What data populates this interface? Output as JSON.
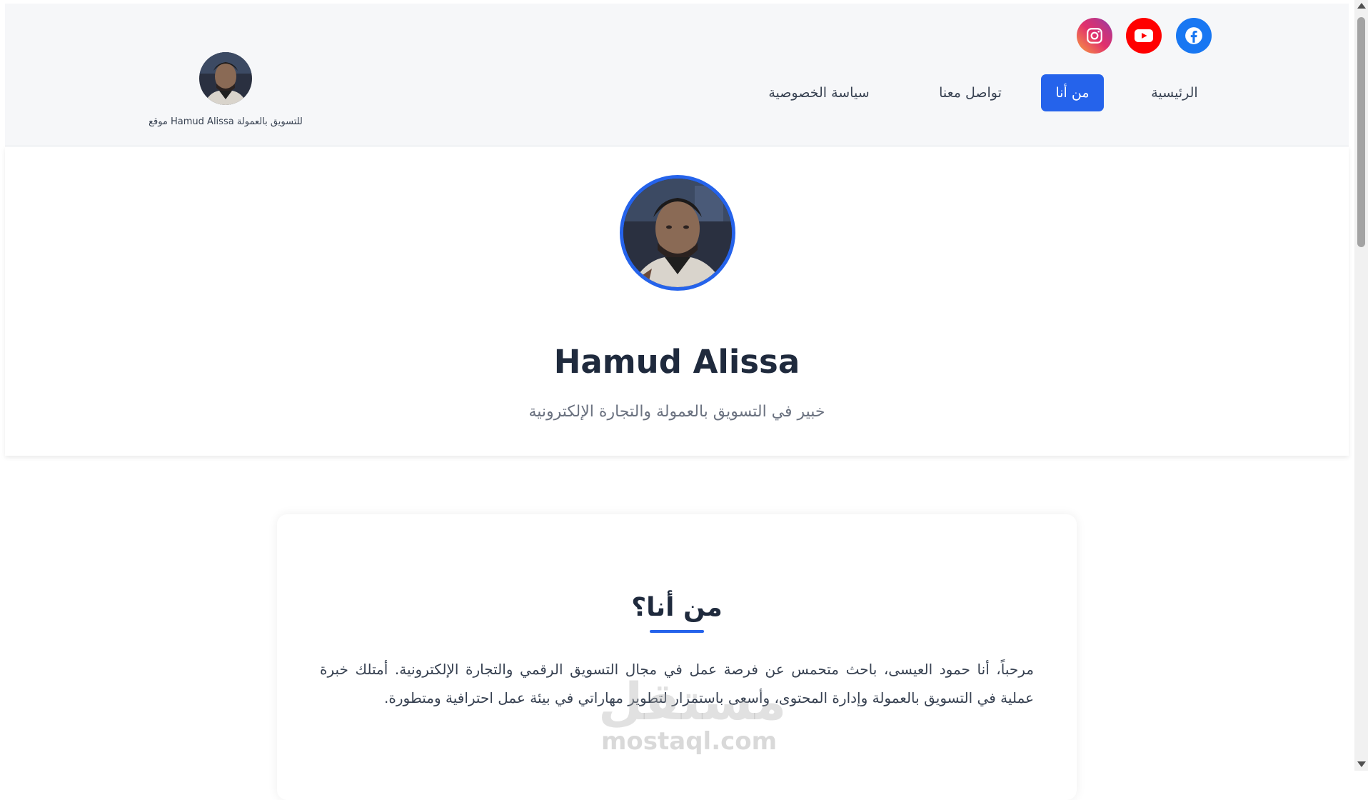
{
  "header": {
    "logo_caption": "موقع Hamud Alissa للتسويق بالعمولة",
    "nav": {
      "home": "الرئيسية",
      "about": "من أنا",
      "contact": "تواصل معنا",
      "privacy": "سياسة الخصوصية"
    },
    "social": [
      "facebook-icon",
      "youtube-icon",
      "instagram-icon"
    ]
  },
  "hero": {
    "name": "Hamud Alissa",
    "subtitle": "خبير في التسويق بالعمولة والتجارة الإلكترونية"
  },
  "about": {
    "title": "من أنا؟",
    "paragraph": "مرحباً، أنا حمود العيسى، باحث متحمس عن فرصة عمل في مجال التسويق الرقمي والتجارة الإلكترونية. أمتلك خبرة عملية في التسويق بالعمولة وإدارة المحتوى، وأسعى باستمرار لتطوير مهاراتي في بيئة عمل احترافية ومتطورة."
  },
  "watermark": {
    "arabic": "مستقل",
    "latin": "mostaql.com"
  },
  "colors": {
    "accent": "#2563eb",
    "facebook": "#1877f2",
    "youtube": "#ff0000",
    "header_bg": "#f6f7f9"
  }
}
